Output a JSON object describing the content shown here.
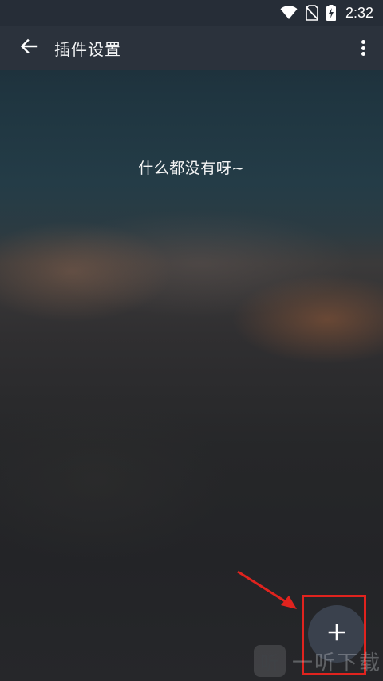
{
  "status_bar": {
    "time": "2:32",
    "icons": [
      "wifi-icon",
      "no-sim-icon",
      "battery-charging-icon"
    ]
  },
  "app_bar": {
    "title": "插件设置",
    "icons": [
      "back-arrow-icon",
      "more-vert-icon"
    ]
  },
  "main": {
    "empty_message": "什么都没有呀~"
  },
  "fab": {
    "icon": "plus-icon"
  },
  "annotation": {
    "highlight_color": "#e0231e"
  },
  "watermark": {
    "logo_glyph": "听",
    "text": "一听下载"
  },
  "colors": {
    "status_bar": "#262d37",
    "app_bar": "#2b323c",
    "fab": "#3a414d"
  }
}
